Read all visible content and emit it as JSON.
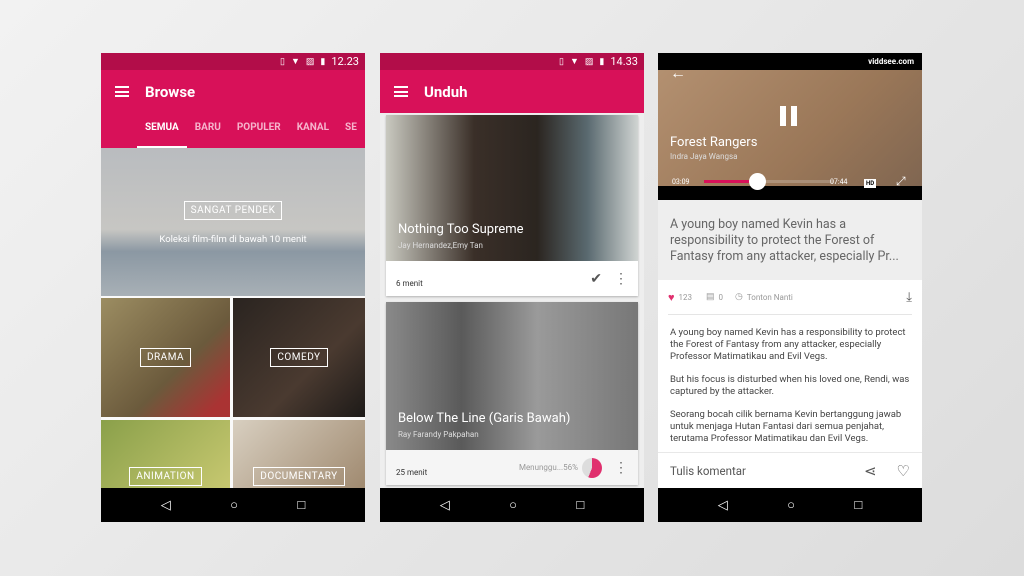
{
  "colors": {
    "accent": "#d81159",
    "status_dark": "#b20d49"
  },
  "browse": {
    "time": "12.23",
    "title": "Browse",
    "tabs": [
      "SEMUA",
      "BARU",
      "POPULER",
      "KANAL",
      "SE"
    ],
    "hero": {
      "label": "SANGAT PENDEK",
      "subtitle": "Koleksi film-film di bawah 10 menit"
    },
    "categories": [
      "DRAMA",
      "COMEDY",
      "ANIMATION",
      "DOCUMENTARY"
    ]
  },
  "downloads": {
    "time": "14.33",
    "title": "Unduh",
    "items": [
      {
        "title": "Nothing Too Supreme",
        "authors": "Jay Hernandez,Emy Tan",
        "duration": "6 menit",
        "status": "downloaded"
      },
      {
        "title": "Below The Line (Garis Bawah)",
        "authors": "Ray Farandy Pakpahan",
        "duration": "25 menit",
        "status_text": "Menunggu...56%",
        "progress": 56
      }
    ]
  },
  "player": {
    "logo": "viddsee.com",
    "title": "Forest Rangers",
    "author": "Indra Jaya Wangsa",
    "elapsed": "03:09",
    "total": "07:44",
    "hd": "HD",
    "progress": 0.41,
    "summary": "A young boy named Kevin has a responsibility to protect the Forest of Fantasy from any attacker, especially Pr...",
    "likes": "123",
    "comments": "0",
    "watch_later": "Tonton Nanti",
    "paragraphs": [
      "A young boy named Kevin has a responsibility to protect the Forest of Fantasy from any attacker, especially Professor Matimatikau and Evil Vegs.",
      "But his focus is disturbed when his loved one, Rendi, was captured by the attacker.",
      "Seorang bocah cilik bernama Kevin bertanggung jawab untuk menjaga Hutan Fantasi dari semua penjahat, terutama Professor Matimatikau dan Evil Vegs."
    ],
    "comment_placeholder": "Tulis komentar"
  }
}
